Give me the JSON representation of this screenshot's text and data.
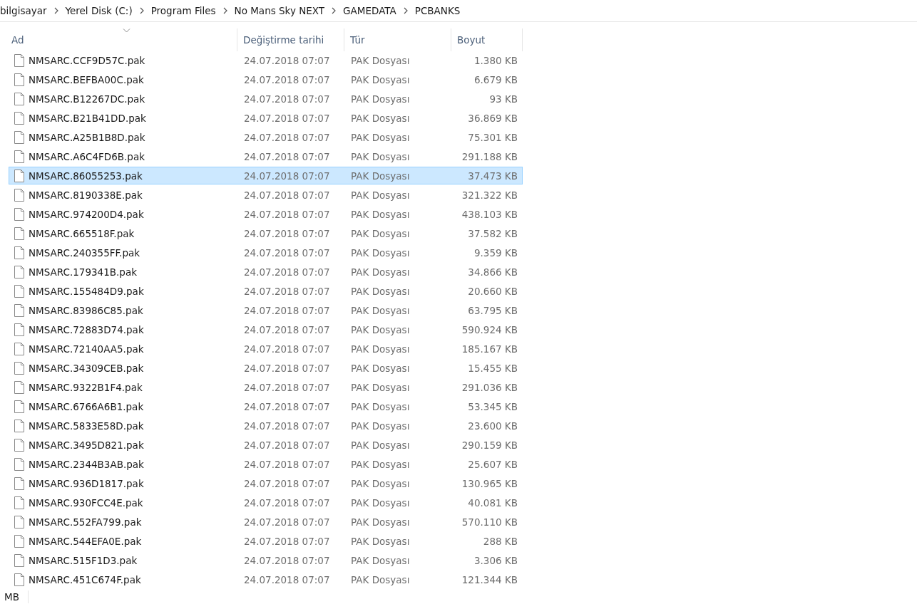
{
  "breadcrumb": [
    "bilgisayar",
    "Yerel Disk (C:)",
    "Program Files",
    "No Mans Sky NEXT",
    "GAMEDATA",
    "PCBANKS"
  ],
  "columns": [
    {
      "label": "Ad",
      "sorted": true
    },
    {
      "label": "Değiştirme tarihi",
      "sorted": false
    },
    {
      "label": "Tür",
      "sorted": false
    },
    {
      "label": "Boyut",
      "sorted": false
    }
  ],
  "rows": [
    {
      "name": "NMSARC.CCF9D57C.pak",
      "date": "24.07.2018 07:07",
      "type": "PAK Dosyası",
      "size": "1.380 KB",
      "selected": false
    },
    {
      "name": "NMSARC.BEFBA00C.pak",
      "date": "24.07.2018 07:07",
      "type": "PAK Dosyası",
      "size": "6.679 KB",
      "selected": false
    },
    {
      "name": "NMSARC.B12267DC.pak",
      "date": "24.07.2018 07:07",
      "type": "PAK Dosyası",
      "size": "93 KB",
      "selected": false
    },
    {
      "name": "NMSARC.B21B41DD.pak",
      "date": "24.07.2018 07:07",
      "type": "PAK Dosyası",
      "size": "36.869 KB",
      "selected": false
    },
    {
      "name": "NMSARC.A25B1B8D.pak",
      "date": "24.07.2018 07:07",
      "type": "PAK Dosyası",
      "size": "75.301 KB",
      "selected": false
    },
    {
      "name": "NMSARC.A6C4FD6B.pak",
      "date": "24.07.2018 07:07",
      "type": "PAK Dosyası",
      "size": "291.188 KB",
      "selected": false
    },
    {
      "name": "NMSARC.86055253.pak",
      "date": "24.07.2018 07:07",
      "type": "PAK Dosyası",
      "size": "37.473 KB",
      "selected": true
    },
    {
      "name": "NMSARC.8190338E.pak",
      "date": "24.07.2018 07:07",
      "type": "PAK Dosyası",
      "size": "321.322 KB",
      "selected": false
    },
    {
      "name": "NMSARC.974200D4.pak",
      "date": "24.07.2018 07:07",
      "type": "PAK Dosyası",
      "size": "438.103 KB",
      "selected": false
    },
    {
      "name": "NMSARC.665518F.pak",
      "date": "24.07.2018 07:07",
      "type": "PAK Dosyası",
      "size": "37.582 KB",
      "selected": false
    },
    {
      "name": "NMSARC.240355FF.pak",
      "date": "24.07.2018 07:07",
      "type": "PAK Dosyası",
      "size": "9.359 KB",
      "selected": false
    },
    {
      "name": "NMSARC.179341B.pak",
      "date": "24.07.2018 07:07",
      "type": "PAK Dosyası",
      "size": "34.866 KB",
      "selected": false
    },
    {
      "name": "NMSARC.155484D9.pak",
      "date": "24.07.2018 07:07",
      "type": "PAK Dosyası",
      "size": "20.660 KB",
      "selected": false
    },
    {
      "name": "NMSARC.83986C85.pak",
      "date": "24.07.2018 07:07",
      "type": "PAK Dosyası",
      "size": "63.795 KB",
      "selected": false
    },
    {
      "name": "NMSARC.72883D74.pak",
      "date": "24.07.2018 07:07",
      "type": "PAK Dosyası",
      "size": "590.924 KB",
      "selected": false
    },
    {
      "name": "NMSARC.72140AA5.pak",
      "date": "24.07.2018 07:07",
      "type": "PAK Dosyası",
      "size": "185.167 KB",
      "selected": false
    },
    {
      "name": "NMSARC.34309CEB.pak",
      "date": "24.07.2018 07:07",
      "type": "PAK Dosyası",
      "size": "15.455 KB",
      "selected": false
    },
    {
      "name": "NMSARC.9322B1F4.pak",
      "date": "24.07.2018 07:07",
      "type": "PAK Dosyası",
      "size": "291.036 KB",
      "selected": false
    },
    {
      "name": "NMSARC.6766A6B1.pak",
      "date": "24.07.2018 07:07",
      "type": "PAK Dosyası",
      "size": "53.345 KB",
      "selected": false
    },
    {
      "name": "NMSARC.5833E58D.pak",
      "date": "24.07.2018 07:07",
      "type": "PAK Dosyası",
      "size": "23.600 KB",
      "selected": false
    },
    {
      "name": "NMSARC.3495D821.pak",
      "date": "24.07.2018 07:07",
      "type": "PAK Dosyası",
      "size": "290.159 KB",
      "selected": false
    },
    {
      "name": "NMSARC.2344B3AB.pak",
      "date": "24.07.2018 07:07",
      "type": "PAK Dosyası",
      "size": "25.607 KB",
      "selected": false
    },
    {
      "name": "NMSARC.936D1817.pak",
      "date": "24.07.2018 07:07",
      "type": "PAK Dosyası",
      "size": "130.965 KB",
      "selected": false
    },
    {
      "name": "NMSARC.930FCC4E.pak",
      "date": "24.07.2018 07:07",
      "type": "PAK Dosyası",
      "size": "40.081 KB",
      "selected": false
    },
    {
      "name": "NMSARC.552FA799.pak",
      "date": "24.07.2018 07:07",
      "type": "PAK Dosyası",
      "size": "570.110 KB",
      "selected": false
    },
    {
      "name": "NMSARC.544EFA0E.pak",
      "date": "24.07.2018 07:07",
      "type": "PAK Dosyası",
      "size": "288 KB",
      "selected": false
    },
    {
      "name": "NMSARC.515F1D3.pak",
      "date": "24.07.2018 07:07",
      "type": "PAK Dosyası",
      "size": "3.306 KB",
      "selected": false
    },
    {
      "name": "NMSARC.451C674F.pak",
      "date": "24.07.2018 07:07",
      "type": "PAK Dosyası",
      "size": "121.344 KB",
      "selected": false
    }
  ],
  "status_bar": {
    "size": "MB"
  }
}
